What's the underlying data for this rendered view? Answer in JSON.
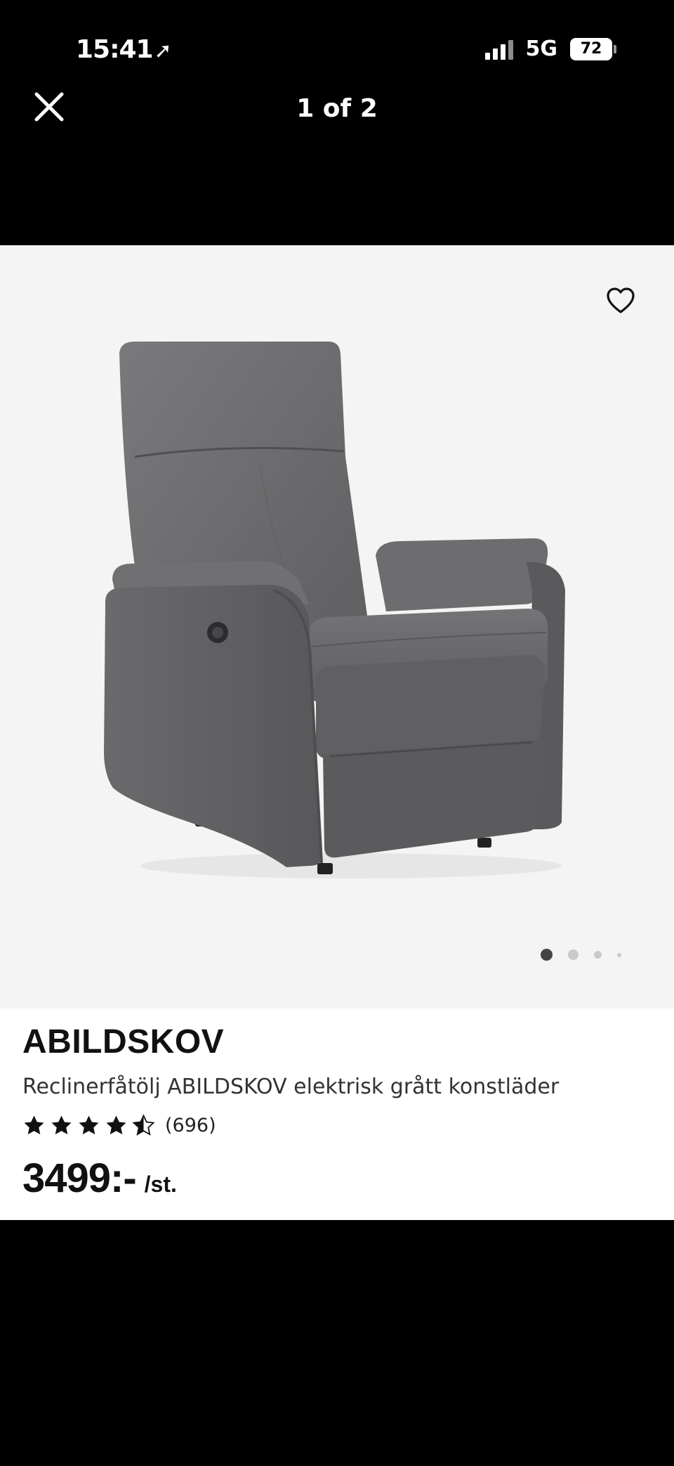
{
  "status_bar": {
    "time": "15:41",
    "network": "5G",
    "battery": "72"
  },
  "viewer": {
    "counter": "1 of 2",
    "close_icon": "close-icon"
  },
  "product": {
    "favorite_icon": "heart-outline-icon",
    "carousel": {
      "total_dots": 4,
      "active_index": 0
    },
    "brand": "ABILDSKOV",
    "description": "Reclinerfåtölj ABILDSKOV elektrisk grått konstläder",
    "rating": {
      "value": 4.5,
      "max": 5,
      "count_label": "(696)"
    },
    "price": {
      "value": "3499:-",
      "unit": "/st."
    }
  },
  "colors": {
    "background_dark": "#000000",
    "image_bg": "#f4f4f4",
    "text_primary": "#111111",
    "chair_gray": "#6b6b6d"
  }
}
